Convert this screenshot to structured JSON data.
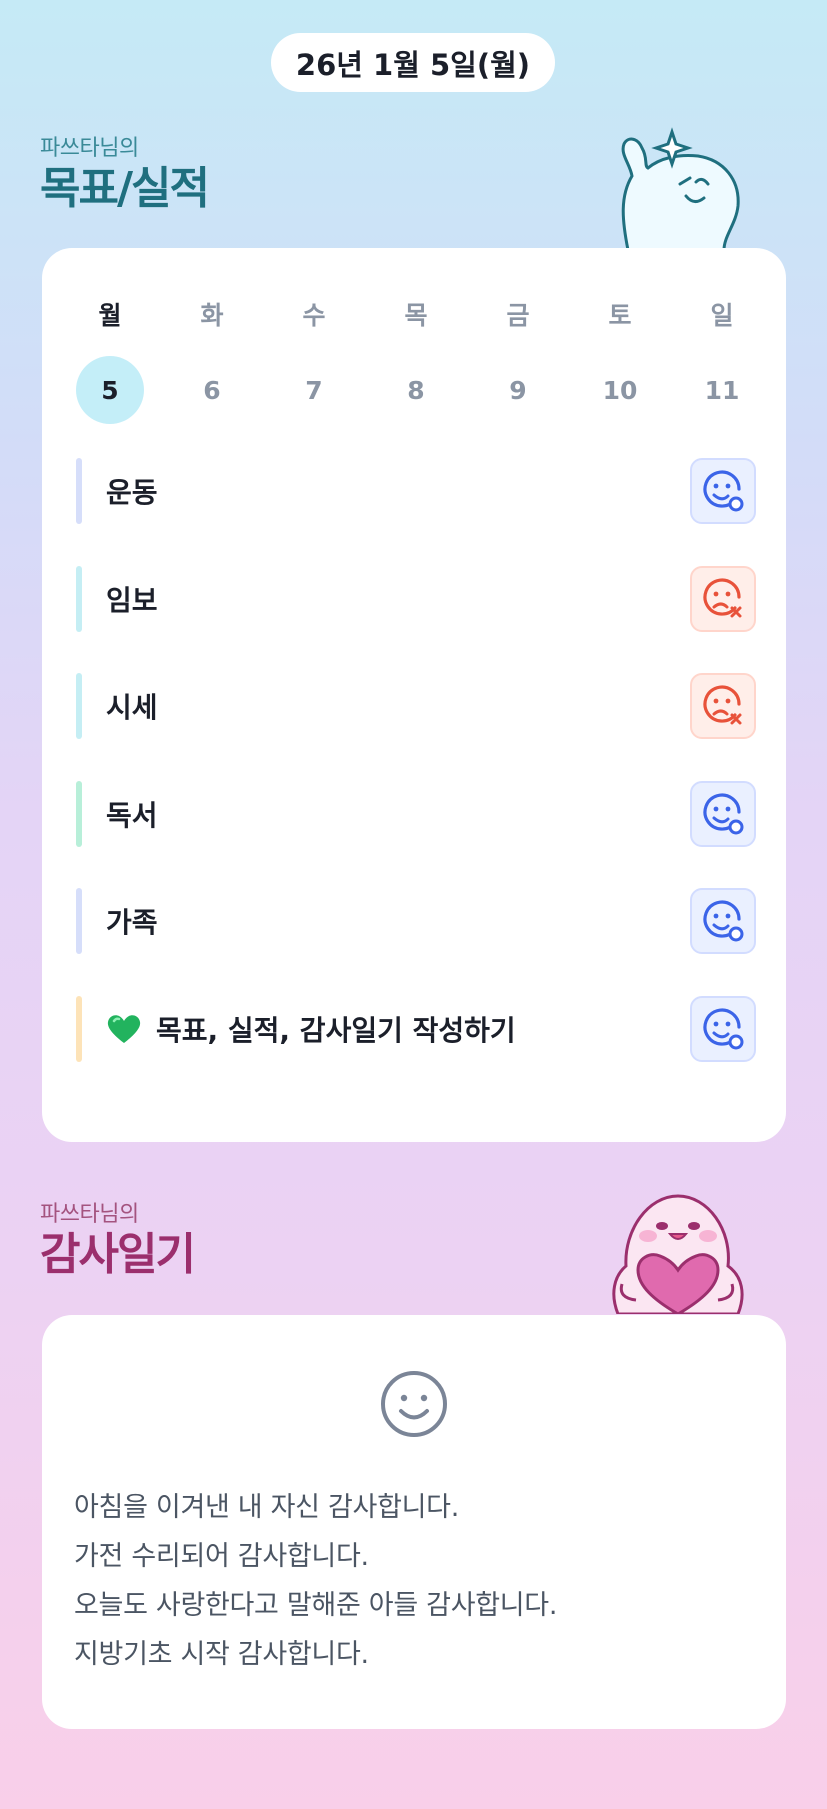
{
  "header": {
    "date": "26년 1월 5일(월)"
  },
  "goals_section": {
    "subtitle": "파쓰타님의",
    "title": "목표/실적"
  },
  "calendar": {
    "weekdays": [
      "월",
      "화",
      "수",
      "목",
      "금",
      "토",
      "일"
    ],
    "dates": [
      "5",
      "6",
      "7",
      "8",
      "9",
      "10",
      "11"
    ],
    "selected_index": 0
  },
  "goals": [
    {
      "label": "운동",
      "status": "done",
      "bar_color": "#d6defa"
    },
    {
      "label": "임보",
      "status": "missed",
      "bar_color": "#c5eef4"
    },
    {
      "label": "시세",
      "status": "missed",
      "bar_color": "#c5eef4"
    },
    {
      "label": "독서",
      "status": "done",
      "bar_color": "#b8efd9"
    },
    {
      "label": "가족",
      "status": "done",
      "bar_color": "#d6defa"
    },
    {
      "label": "목표, 실적, 감사일기 작성하기",
      "status": "done",
      "bar_color": "#fde3b8",
      "icon": "green-heart-icon"
    }
  ],
  "diary_section": {
    "subtitle": "파쓰타님의",
    "title": "감사일기"
  },
  "diary": {
    "mood_icon": "smile-icon",
    "lines": [
      "아침을 이겨낸 내 자신 감사합니다.",
      "가전 수리되어 감사합니다.",
      "오늘도 사랑한다고 말해준 아들 감사합니다.",
      "지방기초 시작 감사합니다."
    ]
  },
  "colors": {
    "done": "#3b64e8",
    "missed": "#e8523a",
    "goals_title": "#1f6f7f",
    "diary_title": "#9b2f6d"
  }
}
